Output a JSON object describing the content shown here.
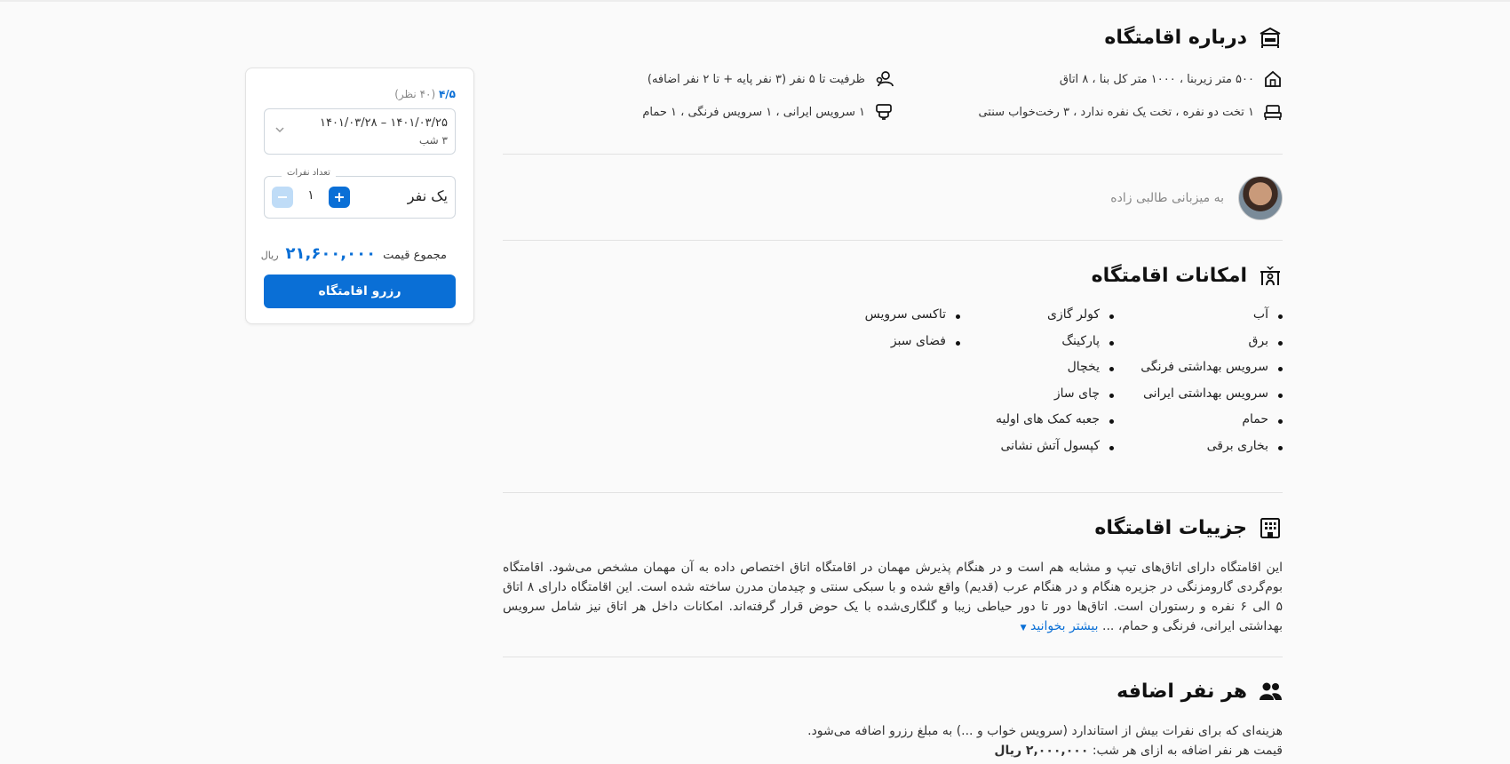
{
  "about": {
    "title": "درباره اقامتگاه",
    "area": "۵۰۰ متر زیربنا ، ۱۰۰۰ متر کل بنا ، ۸ اتاق",
    "capacity": "ظرفیت تا ۵ نفر (۳ نفر پایه + تا ۲ نفر اضافه)",
    "beds": "۱ تخت دو نفره ، تخت یک نفره ندارد ، ۳ رخت‌خواب سنتی",
    "bathrooms": "۱ سرویس ایرانی ، ۱ سرویس فرنگی ، ۱ حمام"
  },
  "host": {
    "label": "به میزبانی طالبی زاده"
  },
  "amenities": {
    "title": "امکانات اقامتگاه",
    "col1": [
      "آب",
      "برق",
      "سرویس بهداشتی فرنگی",
      "سرویس بهداشتی ایرانی",
      "حمام",
      "بخاری برقی"
    ],
    "col2": [
      "کولر گازی",
      "پارکینگ",
      "یخچال",
      "چای ساز",
      "جعبه کمک های اولیه",
      "کپسول آتش نشانی"
    ],
    "col3": [
      "تاکسی سرویس",
      "فضای سبز"
    ]
  },
  "details": {
    "title": "جزییات اقامتگاه",
    "text": "این اقامتگاه دارای اتاق‌های تیپ و مشابه هم است و در هنگام پذیرش مهمان در اقامتگاه اتاق اختصاص داده به آن مهمان مشخص می‌شود. اقامتگاه بوم‌گردی گارومزنگی در جزیره هنگام و در هنگام عرب (قدیم) واقع شده و با سبکی سنتی و چیدمان مدرن ساخته شده است. این اقامتگاه دارای ۸ اتاق ۵ الی ۶ نفره و رستوران است. اتاق‌ها دور تا دور حیاطی زیبا و گلگاری‌شده با یک حوض قرار گرفته‌اند. امکانات داخل هر اتاق نیز شامل سرویس بهداشتی ایرانی، فرنگی و حمام، ...",
    "more": "بیشتر بخوانید"
  },
  "extra": {
    "title": "هر نفر اضافه",
    "text": "هزینه‌ای که برای نفرات بیش از استاندارد (سرویس خواب و ...) به مبلغ رزرو اضافه می‌شود.",
    "price_label": "قیمت هر نفر اضافه به ازای هر شب:",
    "price_value": "۲,۰۰۰,۰۰۰ ریال"
  },
  "booking": {
    "rating": "۴/۵",
    "reviews": "(۴۰ نظر)",
    "dates": "۱۴۰۱/۰۳/۲۵ – ۱۴۰۱/۰۳/۲۸",
    "nights": "۳ شب",
    "guests_label": "تعداد نفرات",
    "guests_value": "یک نفر",
    "guest_count": "۱",
    "total_label": "مجموع قیمت",
    "total_price": "۲۱,۶۰۰,۰۰۰",
    "total_unit": "ریال",
    "reserve_label": "رزرو اقامتگاه"
  },
  "colors": {
    "accent": "#0a6fd6",
    "accent_light": "#bfdcf7",
    "background": "#fafafa"
  },
  "icons": [
    "hotel-icon",
    "house-icon",
    "people-icon",
    "bed-icon",
    "toilet-icon",
    "amenities-icon",
    "building-icon",
    "users-icon",
    "chevron-down-icon",
    "plus-icon",
    "minus-icon"
  ]
}
